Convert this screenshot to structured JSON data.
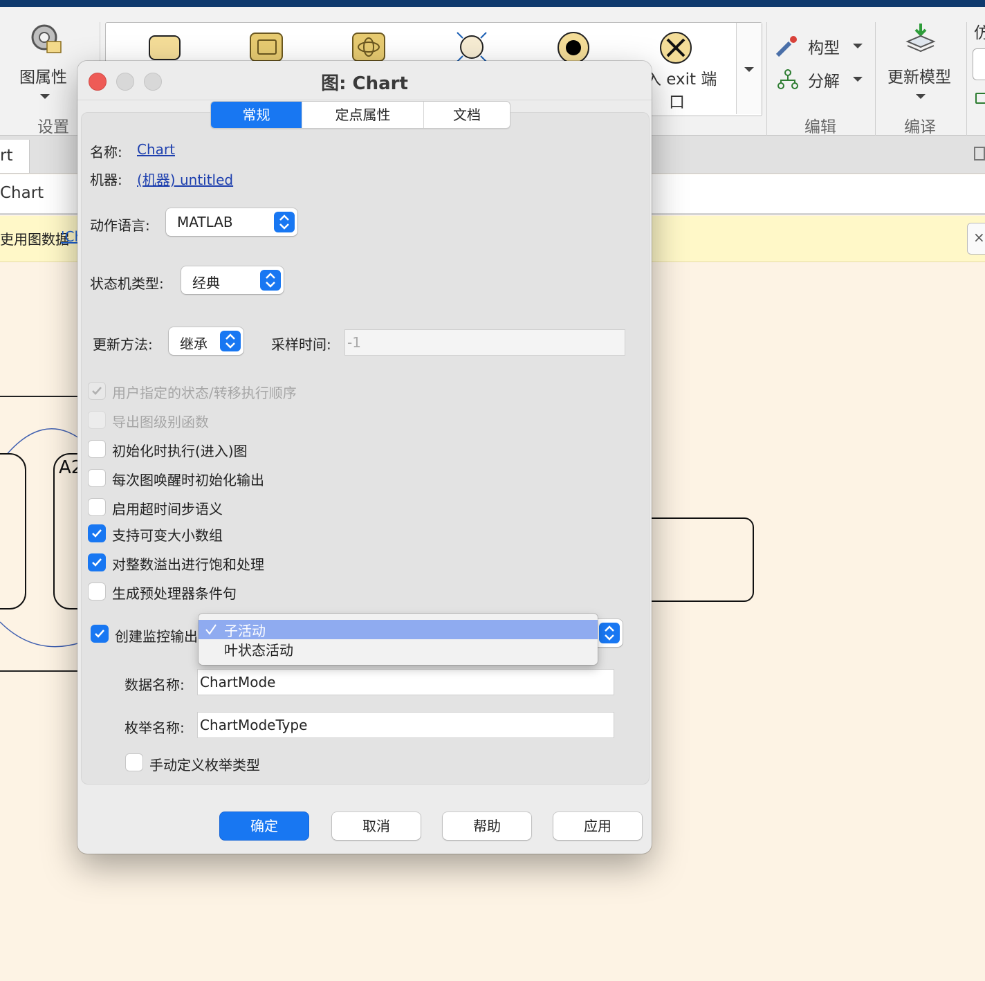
{
  "toolstrip": {
    "chart_properties_label": "图属性",
    "settings_group": "设置",
    "gallery_exit_label": "入 exit 端",
    "gallery_exit_label2": "口",
    "config_label": "构型",
    "decompose_label": "分解",
    "edit_group": "编辑",
    "update_model_label": "更新模型",
    "compile_group": "编译",
    "right_edge_label": "仿"
  },
  "tabbar": {
    "partial_tab": "rt"
  },
  "address": {
    "partial_path": "Chart"
  },
  "infobar": {
    "text_prefix": "吏用图数据 ",
    "text_link": "'Ch"
  },
  "canvas": {
    "state_label": "A2"
  },
  "dialog": {
    "title": "图: Chart",
    "tabs": [
      "常规",
      "定点属性",
      "文档"
    ],
    "active_tab": "常规",
    "name_label": "名称:",
    "name_value": "Chart",
    "machine_label": "机器:",
    "machine_value": "(机器) untitled",
    "action_language_label": "动作语言:",
    "action_language_value": "MATLAB",
    "state_machine_type_label": "状态机类型:",
    "state_machine_type_value": "经典",
    "update_method_label": "更新方法:",
    "update_method_value": "继承",
    "sample_time_label": "采样时间:",
    "sample_time_value": "-1",
    "checkboxes": [
      {
        "label": "用户指定的状态/转移执行顺序",
        "checked": true,
        "enabled": false
      },
      {
        "label": "导出图级别函数",
        "checked": false,
        "enabled": false
      },
      {
        "label": "初始化时执行(进入)图",
        "checked": false,
        "enabled": true
      },
      {
        "label": "每次图唤醒时初始化输出",
        "checked": false,
        "enabled": true
      },
      {
        "label": "启用超时间步语义",
        "checked": false,
        "enabled": true
      },
      {
        "label": "支持可变大小数组",
        "checked": true,
        "enabled": true
      },
      {
        "label": "对整数溢出进行饱和处理",
        "checked": true,
        "enabled": true
      },
      {
        "label": "生成预处理器条件句",
        "checked": false,
        "enabled": true
      }
    ],
    "monitor_output": {
      "label": "创建监控输出",
      "checked": true
    },
    "monitor_dropdown": {
      "options": [
        "子活动",
        "叶状态活动"
      ],
      "selected": "子活动"
    },
    "data_name_label": "数据名称:",
    "data_name_value": "ChartMode",
    "enum_name_label": "枚举名称:",
    "enum_name_value": "ChartModeType",
    "manual_enum": {
      "label": "手动定义枚举类型",
      "checked": false
    },
    "buttons": {
      "ok": "确定",
      "cancel": "取消",
      "help": "帮助",
      "apply": "应用"
    }
  },
  "colors": {
    "accent": "#1877f2",
    "canvas": "#fdf3e4",
    "infobar": "#fff8c8",
    "close": "#ee5b56"
  }
}
